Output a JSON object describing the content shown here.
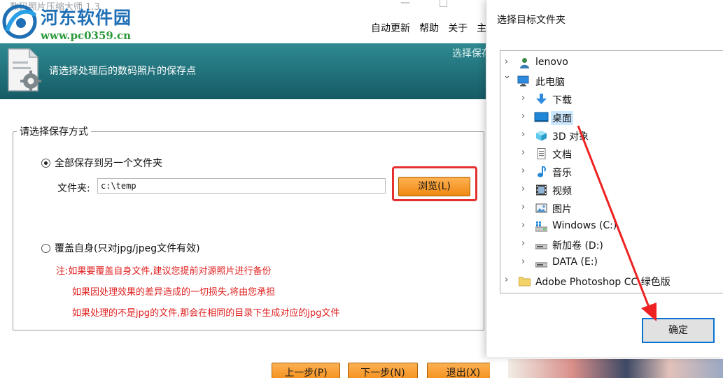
{
  "app": {
    "title": "数码照片压缩大师 1.3",
    "minimize_glyph": "—",
    "watermark": {
      "name": "河东软件园",
      "url": "www.pc0359.cn"
    },
    "menu": [
      "自动更新",
      "帮助",
      "关于",
      "主"
    ],
    "header": {
      "text": "请选择处理后的数码照片的保存点",
      "right_text": "选择保存"
    },
    "group_title": "请选择保存方式",
    "option_all": {
      "label": "全部保存到另一个文件夹",
      "selected": true
    },
    "folder": {
      "label": "文件夹:",
      "value": "c:\\temp"
    },
    "browse_label": "浏览(L)",
    "option_self": {
      "label": "覆盖自身(只对jpg/jpeg文件有效)",
      "selected": false
    },
    "notes": [
      "注:如果要覆盖自身文件,建议您提前对源照片进行备份",
      "如果因处理效果的差异造成的一切损失,将由您承担",
      "如果处理的不是jpg的文件,那会在相同的目录下生成对应的jpg文件"
    ],
    "buttons": {
      "prev": "上一步(P)",
      "next": "下一步(N)",
      "exit": "退出(X)"
    }
  },
  "dialog": {
    "title": "选择目标文件夹",
    "tree": [
      {
        "label": "lenovo",
        "icon": "user-icon",
        "chevron": "›",
        "level": 0
      },
      {
        "label": "此电脑",
        "icon": "computer-icon",
        "chevron": "⌄",
        "level": 0
      },
      {
        "label": "下载",
        "icon": "download-icon",
        "chevron": "›",
        "level": 1
      },
      {
        "label": "桌面",
        "icon": "desktop-icon",
        "chevron": "›",
        "level": 1,
        "selected": true
      },
      {
        "label": "3D 对象",
        "icon": "cube-icon",
        "chevron": "›",
        "level": 1
      },
      {
        "label": "文档",
        "icon": "document-icon",
        "chevron": "›",
        "level": 1
      },
      {
        "label": "音乐",
        "icon": "music-icon",
        "chevron": "›",
        "level": 1
      },
      {
        "label": "视频",
        "icon": "video-icon",
        "chevron": "›",
        "level": 1
      },
      {
        "label": "图片",
        "icon": "picture-icon",
        "chevron": "›",
        "level": 1
      },
      {
        "label": "Windows (C:)",
        "icon": "windows-drive-icon",
        "chevron": "›",
        "level": 1
      },
      {
        "label": "新加卷 (D:)",
        "icon": "drive-icon",
        "chevron": "›",
        "level": 1
      },
      {
        "label": "DATA (E:)",
        "icon": "drive-icon",
        "chevron": "›",
        "level": 1
      },
      {
        "label": "Adobe Photoshop CC  绿色版",
        "icon": "folder-icon",
        "chevron": "›",
        "level": 0
      }
    ],
    "ok_label": "确定"
  },
  "colors": {
    "header_teal": "#1f6f79",
    "button_orange": "#f59a2a",
    "annotation_red": "#e53030",
    "note_red": "#e02020",
    "selection_blue": "#cce8ff",
    "focus_blue": "#0a74d4"
  }
}
